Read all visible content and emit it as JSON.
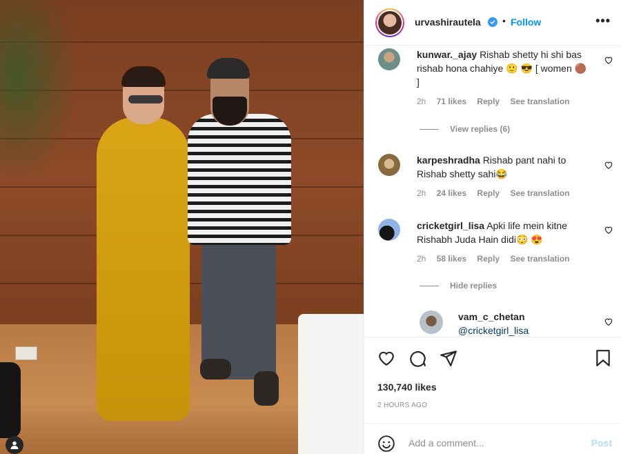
{
  "post": {
    "username": "urvashirautela",
    "follow_label": "Follow",
    "separator": "•",
    "more_label": "•••"
  },
  "comments": [
    {
      "username": "kunwar._ajay",
      "text": "Rishab shetty hi shi bas rishab hona chahiye 🙂 😎 [ women 🟤 ]",
      "time": "2h",
      "likes": "71 likes",
      "reply": "Reply",
      "translate": "See translation",
      "view_replies": "View replies (6)"
    },
    {
      "username": "karpeshradha",
      "text": "Rishab pant nahi to Rishab shetty sahi😂",
      "time": "2h",
      "likes": "24 likes",
      "reply": "Reply",
      "translate": "See translation"
    },
    {
      "username": "cricketgirl_lisa",
      "text": "Apki life mein kitne Rishabh Juda Hain didi😳 😍",
      "time": "2h",
      "likes": "58 likes",
      "reply": "Reply",
      "translate": "See translation",
      "hide_replies": "Hide replies"
    },
    {
      "username": "vam_c_chetan",
      "text": "@cricketgirl_lisa"
    }
  ],
  "stats": {
    "likes": "130,740 likes",
    "time": "2 HOURS AGO"
  },
  "add_comment": {
    "placeholder": "Add a comment...",
    "post_label": "Post"
  },
  "colors": {
    "link": "#0095f6",
    "muted": "#8e8e8e",
    "post_disabled": "#b2dffc"
  },
  "icons": [
    "verified-badge-icon",
    "more-icon",
    "heart-icon",
    "comment-icon",
    "share-icon",
    "bookmark-icon",
    "emoji-icon",
    "user-tag-icon"
  ]
}
